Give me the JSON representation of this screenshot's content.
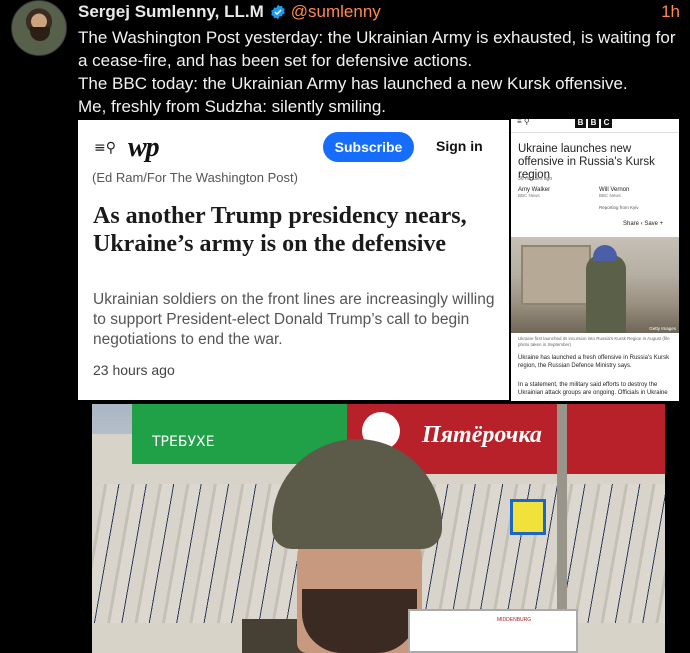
{
  "tweet": {
    "author_name": "Sergej Sumlenny, LL.M",
    "handle": "@sumlenny",
    "time": "1h",
    "lines": [
      "The Washington Post yesterday: the Ukrainian Army is exhausted, is waiting for a cease-fire, and has been set for defensive actions.",
      "The BBC today: the Ukrainian Army has launched a new Kursk offensive.",
      "Me, freshly from Sudzha: silently smiling."
    ],
    "colors": {
      "accent": "#ff8a4c",
      "verified": "#1d9bf0",
      "background": "#000000"
    }
  },
  "wapo": {
    "logo": "wp",
    "subscribe_label": "Subscribe",
    "signin_label": "Sign in",
    "credit": "(Ed Ram/For The Washington Post)",
    "headline": "As another Trump presidency nears, Ukraine’s army is on the defensive",
    "dek": "Ukrainian soldiers on the front lines are increasingly willing to support President-elect Donald Trump’s call to begin negotiations to end the war.",
    "age": "23 hours ago",
    "subscribe_color": "#166dfc"
  },
  "bbc": {
    "logo_letters": [
      "B",
      "B",
      "C"
    ],
    "headline": "Ukraine launches new offensive in Russia's Kursk region",
    "age": "36 minutes ago",
    "author1": {
      "name": "Amy Walker",
      "org": "BBC News"
    },
    "author2": {
      "name": "Will Vernon",
      "org": "BBC News"
    },
    "reporting": "Reporting from Kyiv",
    "share": "Share ‹ Save +",
    "image_credit": "Getty Images",
    "caption": "Ukraine first launched its incursion into Russia's Kursk Region in August (file photo taken in September)",
    "body1": "Ukraine has launched a fresh offensive in Russia's Kursk region, the Russian Defence Ministry says.",
    "body2": "In a statement, the military said efforts to destroy the Ukrainian attack groups are ongoing. Officials in Ukraine"
  },
  "photo": {
    "store_name": "Пятёрочка",
    "green_sign_text": "ТРЕБУХЕ",
    "box_brand": "MIDDENBURG"
  }
}
